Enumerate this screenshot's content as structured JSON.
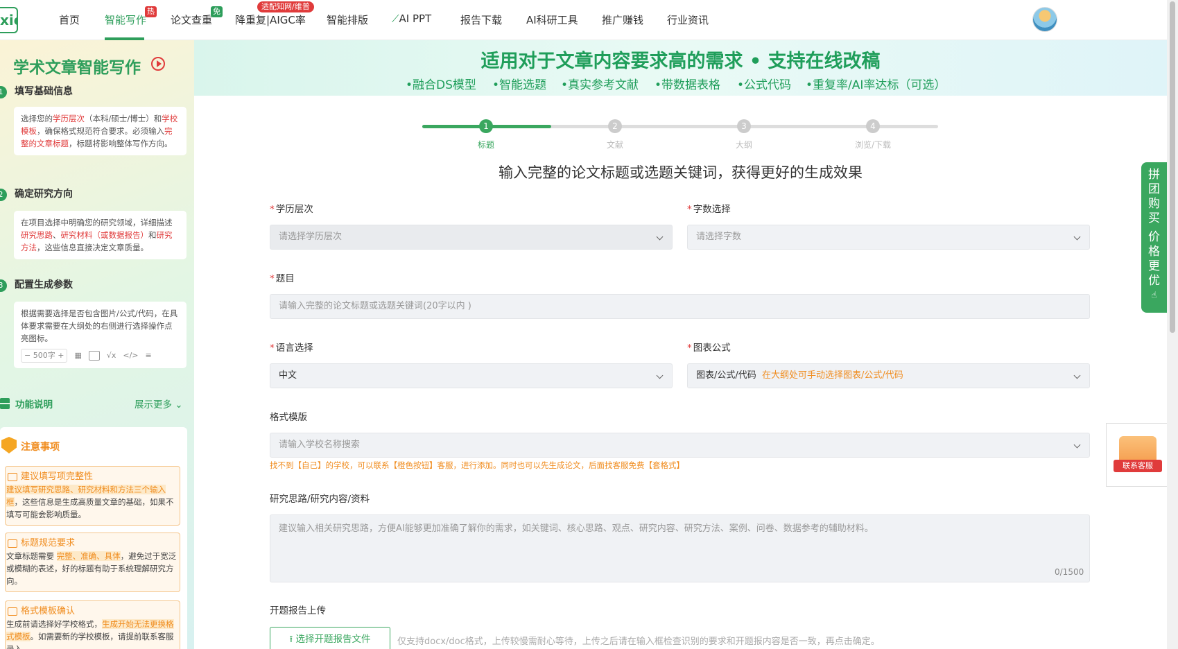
{
  "nav": {
    "logo_text": "xie",
    "items": [
      "首页",
      "智能写作",
      "论文查重",
      "降重复|AIGC率",
      "智能排版",
      "AI PPT",
      "报告下载",
      "AI科研工具",
      "推广赚钱",
      "行业资讯"
    ],
    "badge_hot": "热",
    "badge_free": "免",
    "badge_adapt": "适配知网/维普"
  },
  "left": {
    "title": "学术文章智能写作",
    "steps": [
      {
        "num": "1",
        "title": "填写基础信息"
      },
      {
        "num": "2",
        "title": "确定研究方向"
      },
      {
        "num": "3",
        "title": "配置生成参数"
      }
    ],
    "step1": {
      "a": "选择您的",
      "b": "学历层次",
      "c": "（本科/硕士/博士）和",
      "d": "学校模板",
      "e": "，确保格式规范符合要求。必须输入",
      "f": "完整的文章标题",
      "g": "，标题将影响整体写作方向。"
    },
    "step2": {
      "a": "在项目选择中明确您的研究领域，详细描述",
      "b": "研究思路",
      "c": "、",
      "d": "研究材料（或数据报告）",
      "e": "和",
      "f": "研究方法",
      "g": "，这些信息直接决定文章质量。"
    },
    "step3": {
      "a": "根据需要选择是否包含图片/公式/代码，在具体要求需要在大纲处的右侧进行选择操作点亮图标。",
      "stepper": "− 500字 +"
    },
    "func_label": "功能说明",
    "func_more": "展示更多",
    "notes_title": "注意事项",
    "note1": {
      "title": "建议填写项完整性",
      "hl": "建议填写研究思路、研究材料和方法三个输入框",
      "rest": "，这些信息是生成高质量文章的基础，如果不填写可能会影响质量。"
    },
    "note2": {
      "title": "标题规范要求",
      "a": "文章标题需要 ",
      "hl": "完整、准确、具体",
      "rest": "，避免过于宽泛或模糊的表述，好的标题有助于系统理解研究方向。"
    },
    "note3": {
      "title": "格式模板确认",
      "a": "生成前请选择好学校格式，",
      "hl": "生成开始无法更换格式模板",
      "rest": "。如需要新的学校模板，请提前联系客服录入。"
    }
  },
  "banner": {
    "title": "适用对于文章内容要求高的需求 • 支持在线改稿",
    "features": [
      "•融合DS模型",
      "•智能选题",
      "•真实参考文献",
      "•带数据表格",
      "•公式代码",
      "•重复率/AI率达标（可选）"
    ]
  },
  "stepper": {
    "progress": 0.25,
    "steps": [
      {
        "num": "1",
        "label": "标题"
      },
      {
        "num": "2",
        "label": "文献"
      },
      {
        "num": "3",
        "label": "大纲"
      },
      {
        "num": "4",
        "label": "浏览/下载"
      }
    ]
  },
  "form": {
    "heading": "输入完整的论文标题或选题关键词，获得更好的生成效果",
    "degree_label": "学历层次",
    "degree_placeholder": "请选择学历层次",
    "words_label": "字数选择",
    "words_placeholder": "请选择字数",
    "topic_label": "题目",
    "topic_placeholder": "请输入完整的论文标题或选题关键词(20字以内 )",
    "lang_label": "语言选择",
    "lang_value": "中文",
    "chart_label": "图表公式",
    "chart_value": "图表/公式/代码",
    "chart_note": "在大纲处可手动选择图表/公式/代码",
    "template_label": "格式模版",
    "template_placeholder": "请输入学校名称搜索",
    "template_hint": "找不到【自己】的学校，可以联系【橙色按钮】客服，进行添加。同时也可以先生成论文，后面找客服免费【套格式】",
    "research_label": "研究思路/研究内容/资料",
    "research_placeholder": "建议输入相关研究思路，方便AI能够更加准确了解你的需求，如关键词、核心思路、观点、研究内容、研究方法、案例、问卷、数据参考的辅助材料。",
    "research_counter": "0/1500",
    "upload_label": "开题报告上传",
    "upload_button": "选择开题报告文件",
    "upload_hint": "仅支持docx/doc格式，上传较慢需耐心等待，上传之后请在输入框检查识别的要求和开题报内容是否一致，再点击确定。"
  },
  "float": {
    "groupbuy": [
      "拼",
      "团",
      "购",
      "买",
      "",
      "价",
      "格",
      "更",
      "优"
    ],
    "contact": "联系客服"
  }
}
